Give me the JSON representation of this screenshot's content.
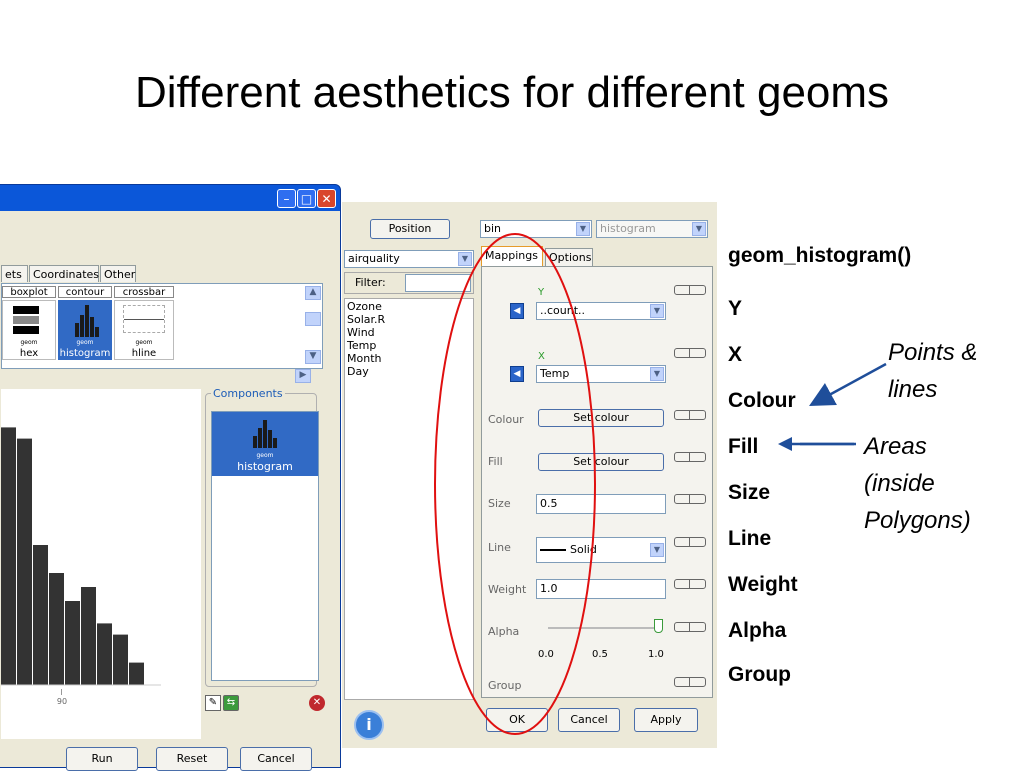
{
  "slide": {
    "title": "Different aesthetics for different geoms"
  },
  "left_window": {
    "tabs": [
      "ets",
      "Coordinates",
      "Other"
    ],
    "geom_columns": [
      {
        "header": "boxplot",
        "small": "geom",
        "label": "hex"
      },
      {
        "header": "contour",
        "small": "geom",
        "label": "histogram",
        "selected": true
      },
      {
        "header": "crossbar",
        "small": "geom",
        "label": "hline"
      }
    ],
    "components_label": "Components",
    "component_item": {
      "small": "geom",
      "label": "histogram"
    },
    "axis_tick": "90",
    "buttons": {
      "run": "Run",
      "reset": "Reset",
      "cancel": "Cancel"
    },
    "histogram_bars": [
      92,
      88,
      50,
      40,
      30,
      35,
      22,
      18,
      8
    ],
    "hist_ylim": [
      0,
      100
    ]
  },
  "right_panel": {
    "position_button": "Position",
    "stat_combo": "bin",
    "geom_combo": "histogram",
    "dataset_combo": "airquality",
    "filter_label": "Filter:",
    "variables": [
      "Ozone",
      "Solar.R",
      "Wind",
      "Temp",
      "Month",
      "Day"
    ],
    "tabs": {
      "mappings": "Mappings",
      "options": "Options"
    },
    "y_letter": "Y",
    "y_value": "..count..",
    "x_letter": "X",
    "x_value": "Temp",
    "colour_label": "Colour",
    "colour_button": "Set colour",
    "fill_label": "Fill",
    "fill_button": "Set colour",
    "size_label": "Size",
    "size_value": "0.5",
    "line_label": "Line",
    "line_value": "Solid",
    "weight_label": "Weight",
    "weight_value": "1.0",
    "alpha_label": "Alpha",
    "alpha_ticks": [
      "0.0",
      "0.5",
      "1.0"
    ],
    "alpha_value": 1.0,
    "group_label": "Group",
    "ok_button": "OK",
    "cancel_button": "Cancel",
    "apply_button": "Apply"
  },
  "aesthetics": {
    "function": "geom_histogram()",
    "items": [
      "Y",
      "X",
      "Colour",
      "Fill",
      "Size",
      "Line",
      "Weight",
      "Alpha",
      "Group"
    ]
  },
  "notes": {
    "points_line1": "Points &",
    "points_line2": "lines",
    "areas_line1": "Areas",
    "areas_line2": "(inside",
    "areas_line3": "Polygons)"
  },
  "colors": {
    "xp_title_blue": "#0b57d9",
    "selection_blue": "#316ac5",
    "ellipse_red": "#e01010",
    "arrow_blue": "#1f4e9a",
    "bar": "#333333"
  }
}
